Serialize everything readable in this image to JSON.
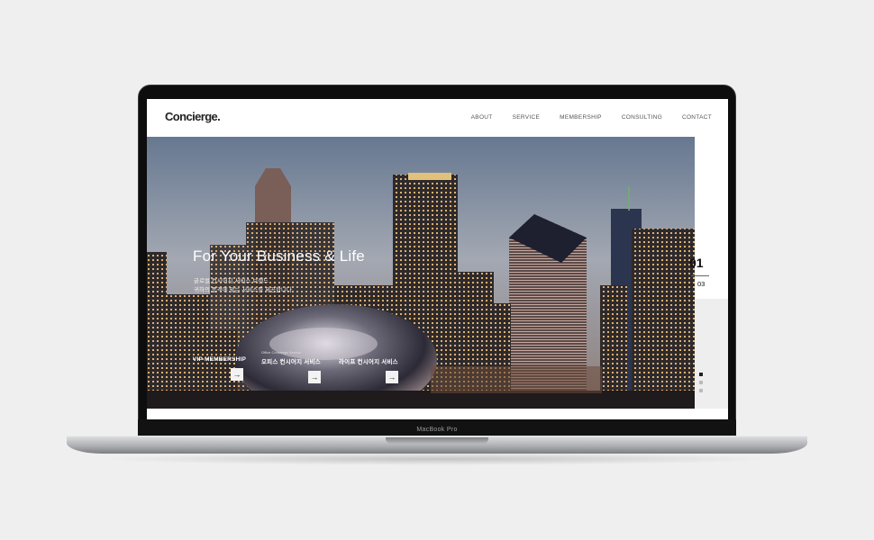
{
  "device": {
    "label": "MacBook Pro"
  },
  "site": {
    "logo": "Concierge.",
    "nav": [
      "ABOUT",
      "SERVICE",
      "MEMBERSHIP",
      "CONSULTING",
      "CONTACT"
    ]
  },
  "hero": {
    "title": "For Your Business & Life",
    "subtitle_lines": [
      "글로벌 컨시어지 서비스 브랜드",
      "귀하의 품격에 맞는 서비스를 제공합니다"
    ],
    "services": [
      {
        "tag": "",
        "label": "VIP MEMBERSHIP",
        "arrow": "→"
      },
      {
        "tag": "Office Concierge Service",
        "label": "오피스 컨시어지 서비스",
        "arrow": "→"
      },
      {
        "tag": "",
        "label": "라이프 컨시어지 서비스",
        "arrow": "→"
      }
    ]
  },
  "slider": {
    "current": "01",
    "total": "03",
    "dots": 3,
    "active_dot": 0
  },
  "colors": {
    "accent": "#222222",
    "panel": "#eeeeee",
    "bezel": "#0d0d0d"
  }
}
